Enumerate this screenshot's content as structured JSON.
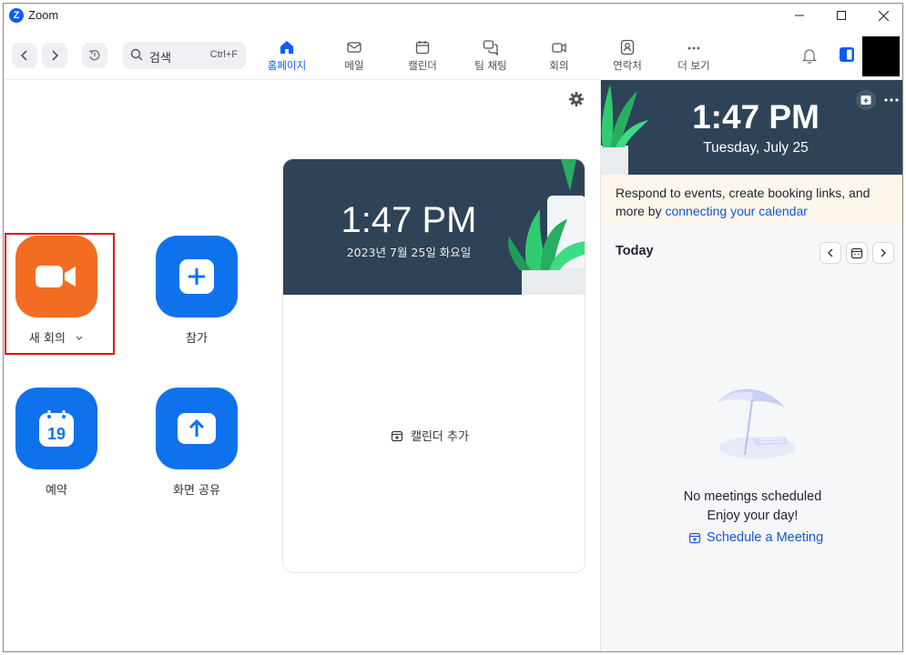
{
  "window": {
    "title": "Zoom"
  },
  "search": {
    "label": "검색",
    "shortcut": "Ctrl+F"
  },
  "tabs": [
    {
      "label": "홈페이지",
      "icon": "home-icon",
      "active": true
    },
    {
      "label": "메일",
      "icon": "mail-icon"
    },
    {
      "label": "캘린더",
      "icon": "calendar-icon"
    },
    {
      "label": "팀 채팅",
      "icon": "chat-icon"
    },
    {
      "label": "회의",
      "icon": "video-icon"
    },
    {
      "label": "연락처",
      "icon": "contacts-icon"
    },
    {
      "label": "더 보기",
      "icon": "more-icon"
    }
  ],
  "actions": {
    "new_meeting": {
      "label": "새 회의"
    },
    "join": {
      "label": "참가"
    },
    "schedule": {
      "label": "예약",
      "day": "19"
    },
    "share": {
      "label": "화면 공유"
    }
  },
  "clock_card": {
    "time": "1:47 PM",
    "date": "2023년 7월 25일 화요일",
    "add_calendar": "캘린더 추가"
  },
  "side_panel": {
    "time": "1:47 PM",
    "date": "Tuesday, July 25",
    "notice_text": "Respond to events, create booking links, and more by ",
    "notice_link": "connecting your calendar",
    "today_label": "Today",
    "empty_title": "No meetings scheduled",
    "empty_sub": "Enjoy your day!",
    "schedule_link": "Schedule a Meeting"
  },
  "colors": {
    "brand_blue": "#0b5cff",
    "tile_blue": "#0e72ed",
    "tile_orange": "#f26d21",
    "hero_bg": "#2f4358",
    "highlight": "#e01010"
  }
}
